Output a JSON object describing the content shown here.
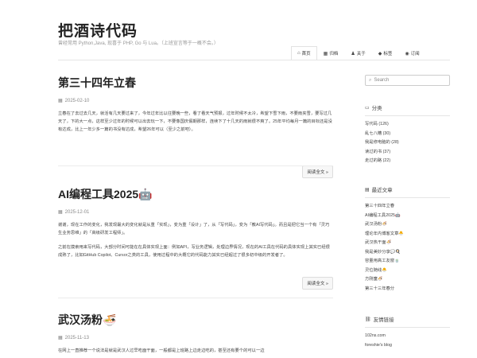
{
  "site": {
    "title": "把酒诗代码",
    "tagline": "曾经常用 Python,Java, 现喜于 PHP, Go 与 Lua。（上班宣言等于一概不会。）"
  },
  "nav": [
    {
      "icon": "home-icon",
      "glyph": "⌂",
      "label": "首页",
      "active": true
    },
    {
      "icon": "archive-icon",
      "glyph": "▦",
      "label": "归档",
      "active": false
    },
    {
      "icon": "user-icon",
      "glyph": "♟",
      "label": "关于",
      "active": false
    },
    {
      "icon": "tag-icon",
      "glyph": "◆",
      "label": "标签",
      "active": false
    },
    {
      "icon": "rss-icon",
      "glyph": "◉",
      "label": "订阅",
      "active": false
    }
  ],
  "posts": [
    {
      "title": "第三十四年立春",
      "date": "2025-02-10",
      "paragraphs": [
        "立春在了去过去几天，就活有几天要过来了，今年过年比以往要晚一些，看了看天气预报，过年时候不太冷，希望下雪下雨，不要雨夹雪，要写过几天了，下的大一点，这样至少过年的时候可以出去玩一下，不要像国庆假期那样，连续下了十几天的雨就很不爽了。25年平均每月一篇的目标还是没有达成，比上一年少多一篇的书没有达成，希望26年可以（至少之前吧）。"
      ],
      "read_more": "阅读全文 »"
    },
    {
      "title": "AI编程工具2025🤖",
      "date": "2025-12-01",
      "paragraphs": [
        "谢谢，现在工作的变化，我发现最大的变化就是从重「实现」，变为重「设计」了，从「写代码」，变为「教AI写代码」。而且是把它当一个有「灵巧生业务思维」的「高级研发工程师」。",
        "之前在摸索用来写代码，大部分时间可能在在具体实现上面：例如API，写业务逻辑，处理边界情况，现在的AI工具在代码的具体实现上其实已经很成熟了，比如GitHub Copilot、Cursor之类的工具，使用过程中的大概它的代码能力其实已经超过了很多初中级的开发者了。"
      ],
      "read_more": "阅读全文 »"
    },
    {
      "title": "武汉汤粉🍜",
      "date": "2025-11-13",
      "paragraphs": [
        "在网上一直推荐一个说法是就是武汉人过早吃面干面，一般都是上班路上边走边吃的，甚至还有要个的可以一边"
      ],
      "read_more": ""
    }
  ],
  "sidebar": {
    "search_placeholder": "Search",
    "categories": {
      "title": "分类",
      "items": [
        "写代码 (126)",
        "乱七八糟 (30)",
        "我是修电脑的 (28)",
        "读过的书 (37)",
        "走过的路 (22)"
      ]
    },
    "recent": {
      "title": "最近文章",
      "items": [
        "第三十四年立春",
        "AI编程工具2025🤖",
        "武汉汤粉🍜",
        "理论年内博客文章🐣",
        "武汉热干面🍜",
        "我是美妙分享💬🍳",
        "容量用高工友窗🍵",
        "灵位随线🐣",
        "方刚童🍜",
        "第三十三年春分"
      ]
    },
    "links": {
      "title": "友情链接",
      "items": [
        "102ns.com",
        "foreshie's blog"
      ]
    }
  }
}
